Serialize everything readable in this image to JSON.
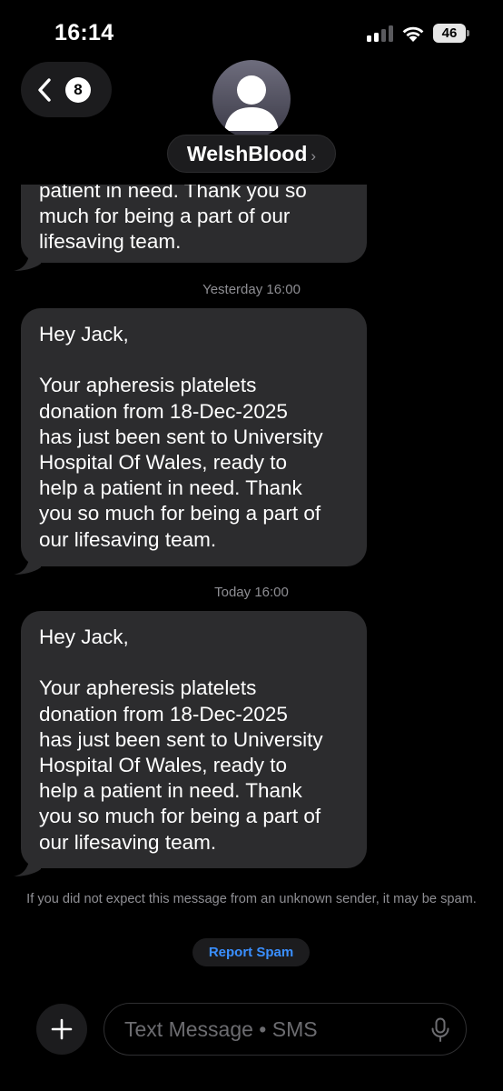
{
  "status_bar": {
    "time": "16:14",
    "battery_level": "46",
    "signal_bars_active": 2,
    "signal_bars_total": 4
  },
  "header": {
    "back_badge_count": "8",
    "contact_name": "WelshBlood",
    "contact_chevron": "›"
  },
  "messages": [
    {
      "text": "patient in need. Thank you so\nmuch for being a part of our\nlifesaving team."
    },
    {
      "timestamp": "Yesterday 16:00",
      "text": "Hey Jack,\n\nYour apheresis platelets\ndonation from 18-Dec-2025\nhas just been sent to University\nHospital Of Wales, ready to\nhelp a patient in need. Thank\nyou so much for being a part of\nour lifesaving team."
    },
    {
      "timestamp": "Today 16:00",
      "text": "Hey Jack,\n\nYour apheresis platelets\ndonation from 18-Dec-2025\nhas just been sent to University\nHospital Of Wales, ready to\nhelp a patient in need. Thank\nyou so much for being a part of\nour lifesaving team."
    }
  ],
  "spam_notice": {
    "text": "If you did not expect this message from an unknown sender, it may be spam.",
    "report_label": "Report Spam"
  },
  "composer": {
    "placeholder": "Text Message • SMS",
    "plus_icon": "plus-icon",
    "mic_icon": "microphone-icon"
  },
  "colors": {
    "background": "#000000",
    "bubble": "#2c2c2e",
    "link": "#3a8fff",
    "secondary_text": "#8e8e93"
  }
}
